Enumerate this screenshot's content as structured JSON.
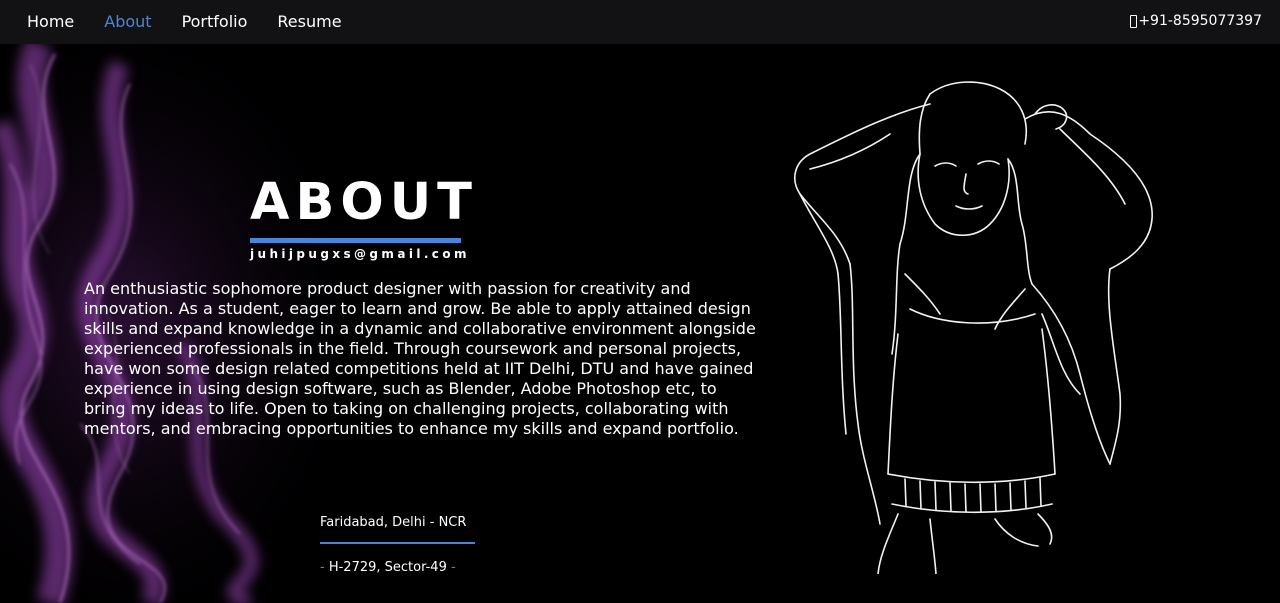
{
  "nav": {
    "items": [
      {
        "label": "Home",
        "active": false
      },
      {
        "label": "About",
        "active": true
      },
      {
        "label": "Portfolio",
        "active": false
      },
      {
        "label": "Resume",
        "active": false
      }
    ],
    "phone": "+91-8595077397",
    "phone_icon": "mobile-phone-icon"
  },
  "about": {
    "title": "ABOUT",
    "email": "juhijpugxs@gmail.com",
    "bio": "An enthusiastic sophomore product designer with passion for creativity and innovation. As a student, eager to learn and grow. Be able to apply attained design skills and expand knowledge in a dynamic and collaborative environment alongside experienced professionals in the field. Through coursework and personal projects, have won some design related competitions held at IIT Delhi, DTU and have gained experience in using design software, such as Blender, Adobe Photoshop etc, to bring my ideas to life. Open to taking on challenging projects, collaborating with mentors, and embracing opportunities to enhance my skills and expand portfolio.",
    "location": "Faridabad, Delhi - NCR",
    "address": "H-2729, Sector-49"
  },
  "colors": {
    "accent": "#4a86d8",
    "nav_bg": "#121214",
    "background": "#000000",
    "smoke": "#9b3fb5"
  }
}
